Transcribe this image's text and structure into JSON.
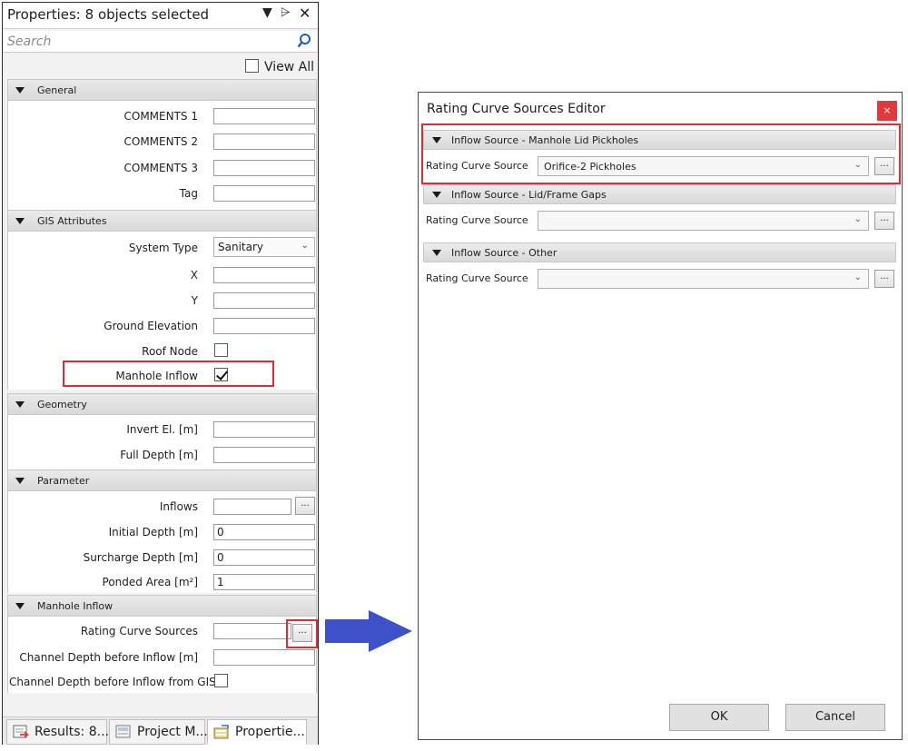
{
  "properties_panel": {
    "title": "Properties: 8 objects selected",
    "search_placeholder": "Search",
    "view_all_label": "View All",
    "sections": {
      "general": {
        "title": "General",
        "fields": {
          "comments1": {
            "label": "COMMENTS 1",
            "value": ""
          },
          "comments2": {
            "label": "COMMENTS 2",
            "value": ""
          },
          "comments3": {
            "label": "COMMENTS 3",
            "value": ""
          },
          "tag": {
            "label": "Tag",
            "value": ""
          }
        }
      },
      "gis": {
        "title": "GIS Attributes",
        "fields": {
          "system_type": {
            "label": "System Type",
            "value": "Sanitary"
          },
          "x": {
            "label": "X",
            "value": ""
          },
          "y": {
            "label": "Y",
            "value": ""
          },
          "ground_elevation": {
            "label": "Ground Elevation",
            "value": ""
          },
          "roof_node": {
            "label": "Roof Node",
            "checked": false
          },
          "manhole_inflow": {
            "label": "Manhole Inflow",
            "checked": true
          }
        }
      },
      "geometry": {
        "title": "Geometry",
        "fields": {
          "invert_el": {
            "label": "Invert El. [m]",
            "value": ""
          },
          "full_depth": {
            "label": "Full Depth [m]",
            "value": ""
          }
        }
      },
      "parameter": {
        "title": "Parameter",
        "fields": {
          "inflows": {
            "label": "Inflows",
            "value": ""
          },
          "initial_depth": {
            "label": "Initial Depth [m]",
            "value": "0"
          },
          "surcharge_depth": {
            "label": "Surcharge Depth [m]",
            "value": "0"
          },
          "ponded_area": {
            "label": "Ponded Area [m²]",
            "value": "1"
          }
        }
      },
      "manhole_inflow": {
        "title": "Manhole Inflow",
        "fields": {
          "rating_curve_sources": {
            "label": "Rating Curve Sources",
            "value": ""
          },
          "channel_depth": {
            "label": "Channel Depth before Inflow [m]",
            "value": ""
          },
          "channel_depth_gis": {
            "label": "Channel Depth before Inflow from GIS",
            "checked": false
          }
        }
      }
    },
    "ellipsis": "...",
    "tabs": [
      {
        "label": "Results: 8...",
        "icon": "results-icon"
      },
      {
        "label": "Project M...",
        "icon": "project-manager-icon"
      },
      {
        "label": "Propertie...",
        "icon": "properties-icon",
        "active": true
      }
    ]
  },
  "dialog": {
    "title": "Rating Curve Sources Editor",
    "close_glyph": "×",
    "groups": [
      {
        "title": "Inflow Source - Manhole Lid Pickholes",
        "label": "Rating Curve Source",
        "value": "Orifice-2 Pickholes"
      },
      {
        "title": "Inflow Source - Lid/Frame Gaps",
        "label": "Rating Curve Source",
        "value": ""
      },
      {
        "title": "Inflow Source - Other",
        "label": "Rating Curve Source",
        "value": ""
      }
    ],
    "ok_label": "OK",
    "cancel_label": "Cancel"
  },
  "colors": {
    "highlight": "#e02b35",
    "arrow": "#3f51c9",
    "close_button": "#e03a3e"
  }
}
